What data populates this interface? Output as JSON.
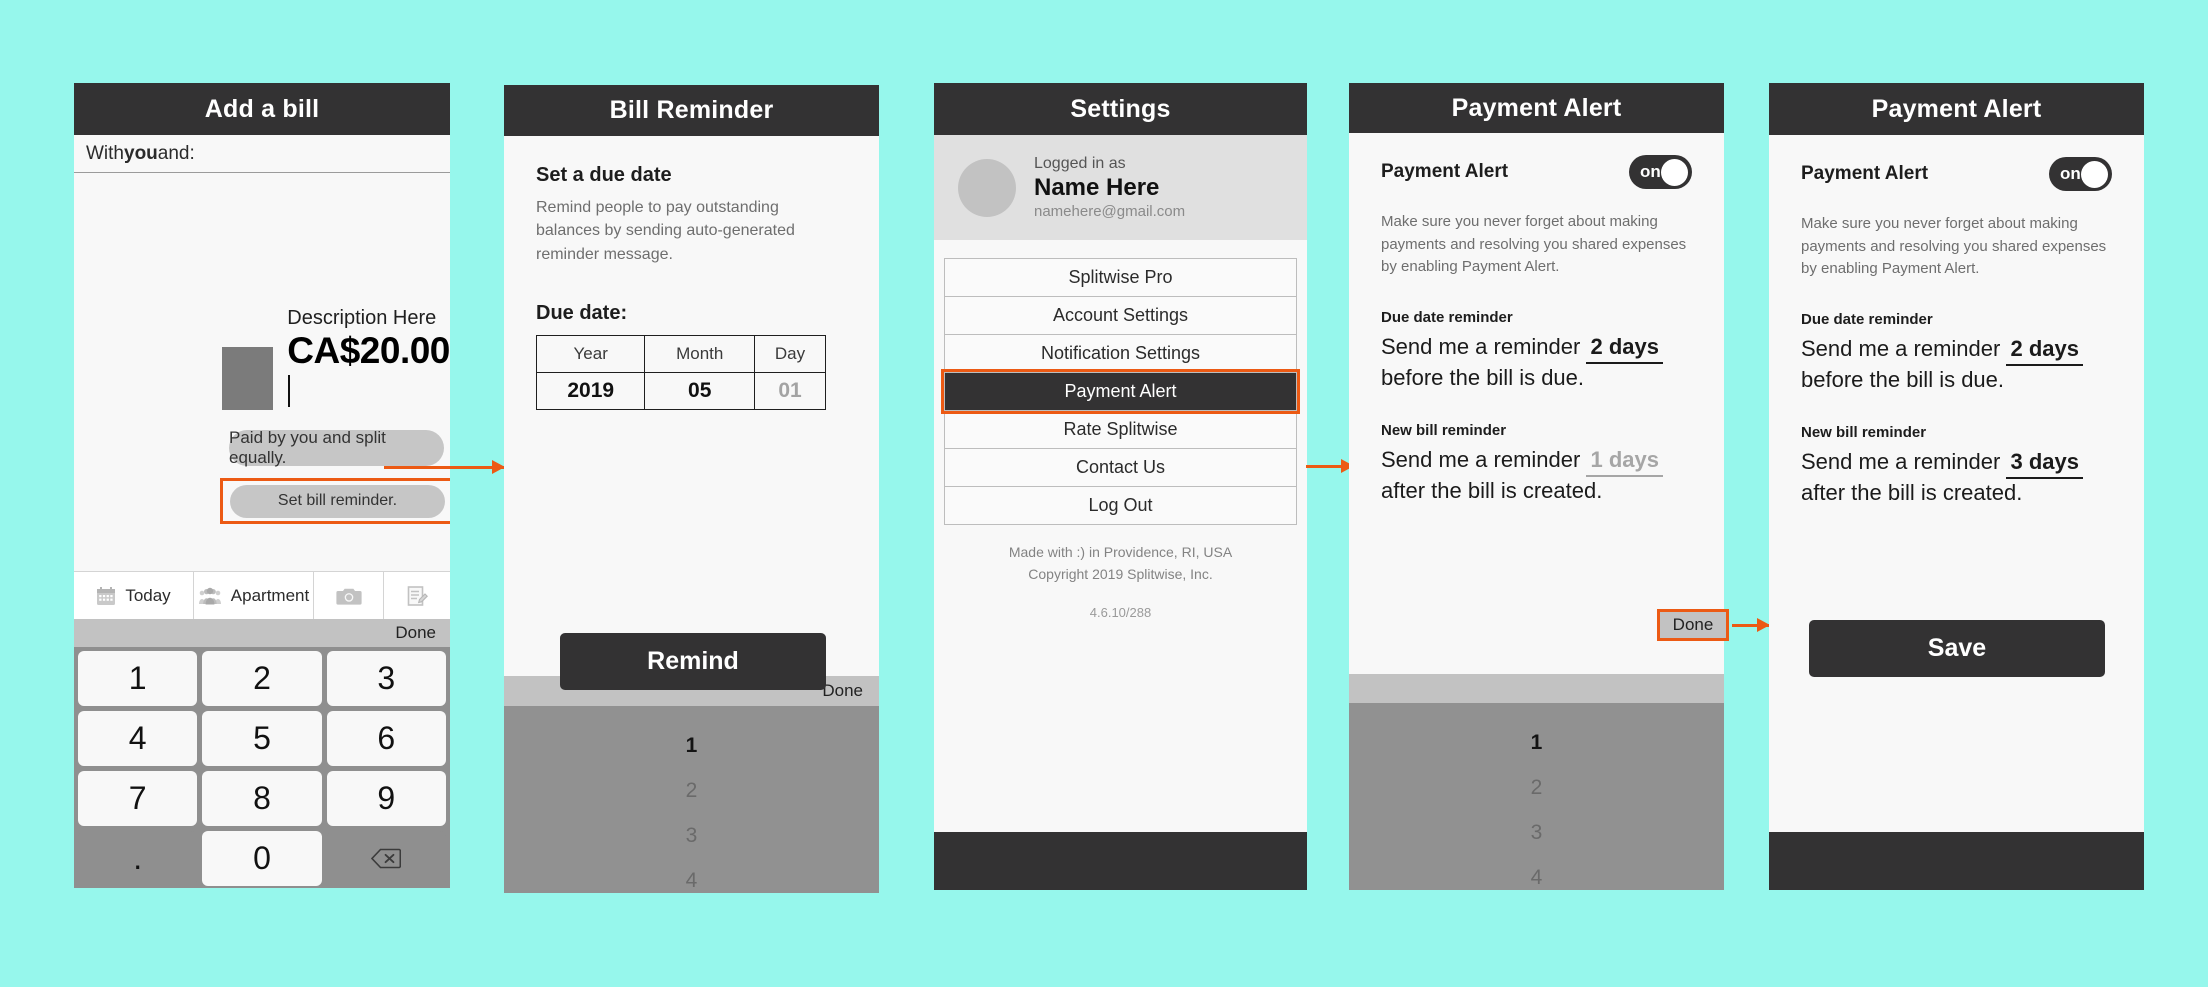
{
  "theme": {
    "background": "#96f7ec",
    "accent": "#ec5a14",
    "dark": "#333233"
  },
  "add_bill": {
    "title": "Add a bill",
    "with_prefix": "With ",
    "with_strong": "you",
    "with_suffix": " and:",
    "description": "Description Here",
    "amount": "CA$20.00",
    "paid_pill": "Paid by you and split equally.",
    "reminder_pill": "Set bill reminder.",
    "tabs": [
      {
        "label": "Today",
        "icon": "calendar-icon"
      },
      {
        "label": "Apartment",
        "icon": "group-icon"
      },
      {
        "label": "",
        "icon": "camera-icon"
      },
      {
        "label": "",
        "icon": "note-icon"
      }
    ],
    "done_label": "Done",
    "keypad": [
      [
        "1",
        "2",
        "3"
      ],
      [
        "4",
        "5",
        "6"
      ],
      [
        "7",
        "8",
        "9"
      ],
      [
        ".",
        "0",
        "delete-icon"
      ]
    ]
  },
  "bill_reminder": {
    "title": "Bill Reminder",
    "heading": "Set a due date",
    "description": "Remind people to pay outstanding balances by sending auto-generated reminder message.",
    "due_label": "Due date:",
    "date_headers": [
      "Year",
      "Month",
      "Day"
    ],
    "date_values": [
      "2019",
      "05",
      "01"
    ],
    "remind_button": "Remind",
    "picker_done": "Done",
    "picker_values": [
      "1",
      "2",
      "3",
      "4"
    ],
    "picker_selected": "1"
  },
  "settings": {
    "title": "Settings",
    "logged_in_as": "Logged in as",
    "name": "Name Here",
    "email": "namehere@gmail.com",
    "menu": [
      "Splitwise Pro",
      "Account Settings",
      "Notification Settings",
      "Payment Alert",
      "Rate Splitwise",
      "Contact Us",
      "Log Out"
    ],
    "active_menu": "Payment Alert",
    "made_with_line1": "Made with :) in Providence, RI, USA",
    "made_with_line2": "Copyright 2019 Splitwise, Inc.",
    "version": "4.6.10/288"
  },
  "payment_alert_4": {
    "title": "Payment Alert",
    "section_title": "Payment Alert",
    "toggle_label": "on",
    "description": "Make sure you never forget about making payments and resolving you shared expenses by enabling Payment Alert.",
    "due_label": "Due date reminder",
    "due_prefix": "Send me a reminder",
    "due_number": "2",
    "due_unit": "days",
    "due_suffix": "before the bill is due.",
    "new_label": "New bill reminder",
    "new_prefix": "Send me a reminder",
    "new_number": "1",
    "new_unit": "days",
    "new_suffix": "after the bill is created.",
    "done_label": "Done",
    "picker_values": [
      "1",
      "2",
      "3",
      "4"
    ],
    "picker_selected": "1"
  },
  "payment_alert_5": {
    "title": "Payment Alert",
    "section_title": "Payment Alert",
    "toggle_label": "on",
    "description": "Make sure you never forget about making payments and resolving you shared expenses by enabling Payment Alert.",
    "due_label": "Due date reminder",
    "due_prefix": "Send me a reminder",
    "due_number": "2",
    "due_unit": "days",
    "due_suffix": "before the bill is due.",
    "new_label": "New bill reminder",
    "new_prefix": "Send me a reminder",
    "new_number": "3",
    "new_unit": "days",
    "new_suffix": "after the bill is created.",
    "save_button": "Save"
  }
}
